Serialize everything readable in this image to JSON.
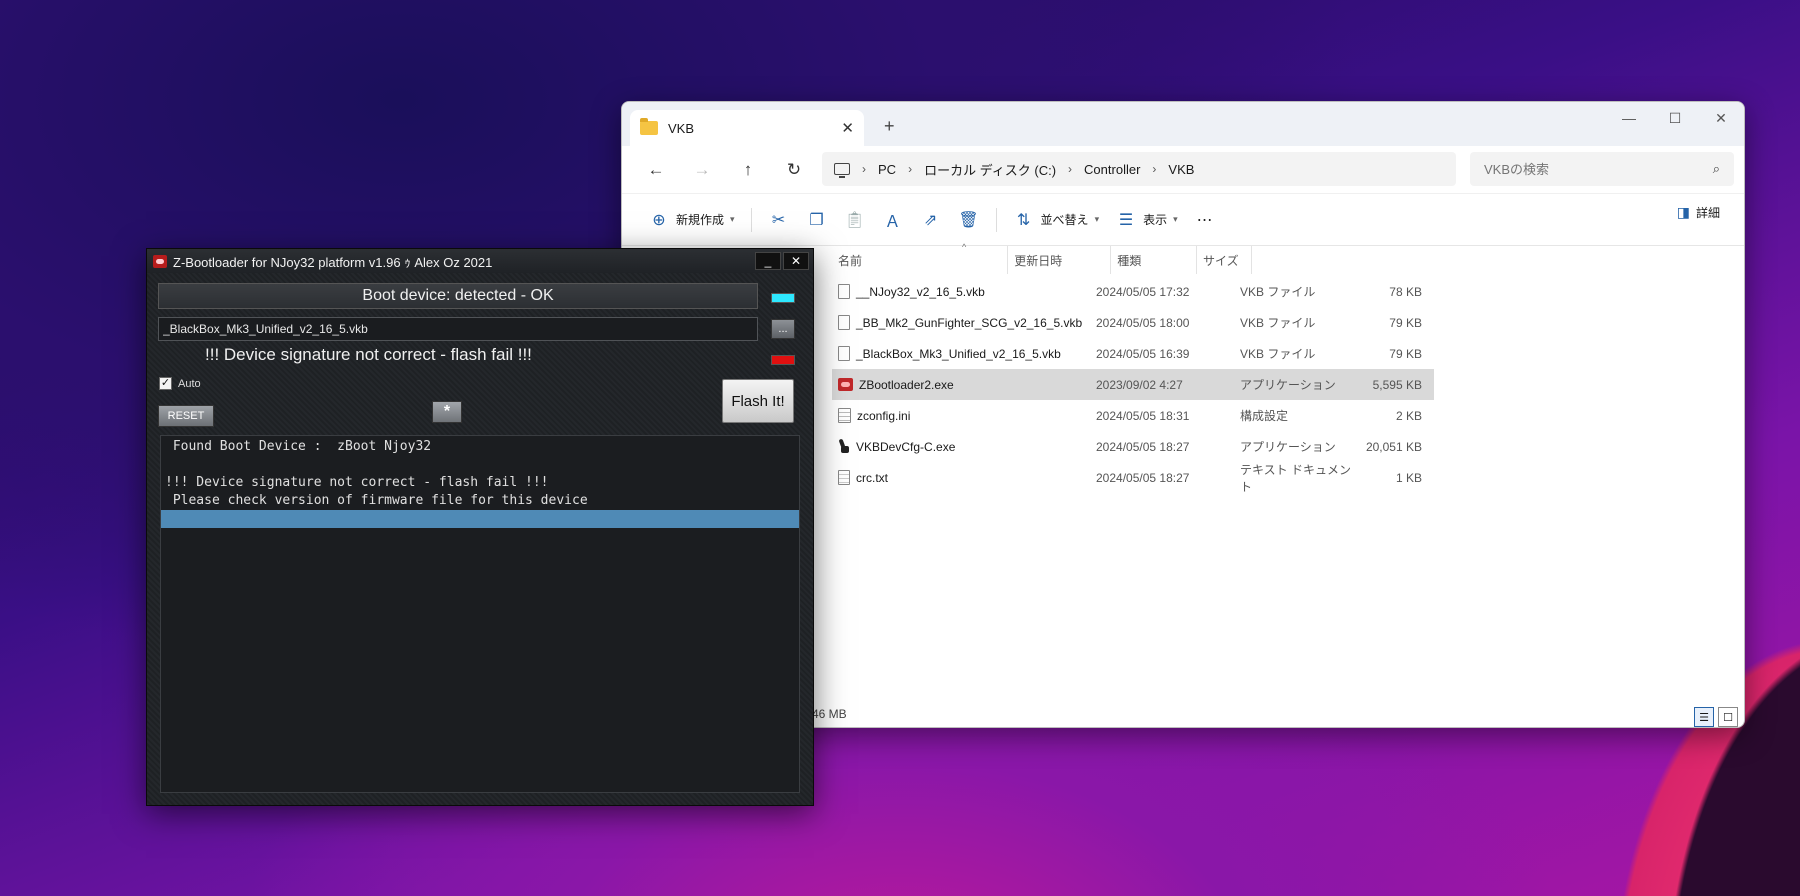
{
  "explorer": {
    "tab_title": "VKB",
    "breadcrumb": [
      "PC",
      "ローカル ディスク (C:)",
      "Controller",
      "VKB"
    ],
    "search_placeholder": "VKBの検索",
    "toolbar": {
      "new_label": "新規作成",
      "sort_label": "並べ替え",
      "view_label": "表示",
      "details_label": "詳細"
    },
    "columns": {
      "name": "名前",
      "date": "更新日時",
      "type": "種類",
      "size": "サイズ"
    },
    "files": [
      {
        "name": "__NJoy32_v2_16_5.vkb",
        "date": "2024/05/05 17:32",
        "type": "VKB ファイル",
        "size": "78 KB",
        "icon": "document-icon"
      },
      {
        "name": "_BB_Mk2_GunFighter_SCG_v2_16_5.vkb",
        "date": "2024/05/05 18:00",
        "type": "VKB ファイル",
        "size": "79 KB",
        "icon": "document-icon"
      },
      {
        "name": "_BlackBox_Mk3_Unified_v2_16_5.vkb",
        "date": "2024/05/05 16:39",
        "type": "VKB ファイル",
        "size": "79 KB",
        "icon": "document-icon"
      },
      {
        "name": "ZBootloader2.exe",
        "date": "2023/09/02 4:27",
        "type": "アプリケーション",
        "size": "5,595 KB",
        "icon": "app-icon"
      },
      {
        "name": "zconfig.ini",
        "date": "2024/05/05 18:31",
        "type": "構成設定",
        "size": "2 KB",
        "icon": "settings-file-icon"
      },
      {
        "name": "VKBDevCfg-C.exe",
        "date": "2024/05/05 18:27",
        "type": "アプリケーション",
        "size": "20,051 KB",
        "icon": "tool-icon"
      },
      {
        "name": "crc.txt",
        "date": "2024/05/05 18:27",
        "type": "テキスト ドキュメント",
        "size": "1 KB",
        "icon": "text-file-icon"
      }
    ],
    "status_text": "46 MB"
  },
  "zboot": {
    "title": "Z-Bootloader for NJoy32 platform v1.96 ｩ Alex Oz 2021",
    "boot_status": "Boot device: detected - OK",
    "file_value": "_BlackBox_Mk3_Unified_v2_16_5.vkb",
    "browse_label": "...",
    "signature_message": "!!! Device signature not correct - flash fail !!!",
    "auto_label": "Auto",
    "reset_label": "RESET",
    "star_label": "*",
    "flash_label": "Flash It!",
    "minimize_label": "_",
    "close_label": "✕",
    "log_lines": [
      " Found Boot Device :  zBoot Njoy32",
      "",
      "!!! Device signature not correct - flash fail !!!",
      " Please check version of firmware file for this device",
      ""
    ],
    "led_colors": {
      "status": "#2ee8ff",
      "error": "#e01010"
    }
  }
}
